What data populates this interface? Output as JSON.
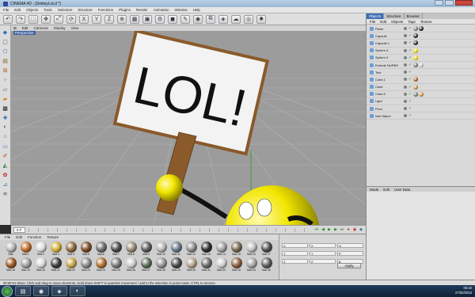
{
  "window": {
    "title": "CINEMA 4D - [SmileyLoLd *]"
  },
  "menubar": {
    "items": [
      "File",
      "Edit",
      "Objects",
      "Tools",
      "Selection",
      "Structure",
      "Functions",
      "Plugins",
      "Render",
      "Animation",
      "Window",
      "Help"
    ]
  },
  "viewport": {
    "menu": [
      "Edit",
      "Cameras",
      "Display",
      "View"
    ],
    "label": "Perspective",
    "sign_text": "LOL!"
  },
  "timeline": {
    "frame": "0 F"
  },
  "material_panel": {
    "menu": [
      "File",
      "Edit",
      "Function",
      "Texture"
    ],
    "materials": [
      {
        "name": "Mat",
        "color": "#b9b9b9"
      },
      {
        "name": "Mat.1",
        "color": "#c06a2a"
      },
      {
        "name": "Mat.2",
        "color": "#dcdcdc"
      },
      {
        "name": "Mat.3",
        "color": "#d4b23a"
      },
      {
        "name": "Mat.4",
        "color": "#8c6b3e"
      },
      {
        "name": "Mat.5",
        "color": "#7c4a22"
      },
      {
        "name": "Mat.6",
        "color": "#6f6f6f"
      },
      {
        "name": "Mat.7",
        "color": "#4a4a4a"
      },
      {
        "name": "Mat.8",
        "color": "#9a8c76"
      },
      {
        "name": "Mat.9",
        "color": "#5c5c5c"
      },
      {
        "name": "Mat.10",
        "color": "#b8b8b8"
      },
      {
        "name": "Mat.11",
        "color": "#6a7a8a"
      },
      {
        "name": "Mat.12",
        "color": "#8e8e8e"
      },
      {
        "name": "Mat.13",
        "color": "#2e2e2e"
      },
      {
        "name": "Mat.14",
        "color": "#a3a3a3"
      },
      {
        "name": "Mat.15",
        "color": "#7a6a52"
      },
      {
        "name": "Mat.16",
        "color": "#c2c2c2"
      },
      {
        "name": "Mat.17",
        "color": "#505050"
      },
      {
        "name": "Mat.18",
        "color": "#9a5a2a"
      },
      {
        "name": "Mat.19",
        "color": "#a0a0a0"
      },
      {
        "name": "Mat.20",
        "color": "#d9d9d9"
      },
      {
        "name": "Mat.21",
        "color": "#3c3c3c"
      },
      {
        "name": "Mat.22",
        "color": "#c8a850"
      },
      {
        "name": "Mat.23",
        "color": "#8a8a8a"
      },
      {
        "name": "Mat.24",
        "color": "#b07030"
      },
      {
        "name": "Mat.25",
        "color": "#7a7a7a"
      },
      {
        "name": "Mat.26",
        "color": "#cfcfcf"
      },
      {
        "name": "Mat.27",
        "color": "#5a6e5a"
      },
      {
        "name": "Mat.28",
        "color": "#959595"
      },
      {
        "name": "Mat.29",
        "color": "#484848"
      },
      {
        "name": "Mat.30",
        "color": "#b5a590"
      },
      {
        "name": "Mat.31",
        "color": "#6c6c6c"
      },
      {
        "name": "Mat.32",
        "color": "#d0d0d0"
      },
      {
        "name": "Mat.33",
        "color": "#8a6040"
      },
      {
        "name": "Mat.34",
        "color": "#a8a8a8"
      },
      {
        "name": "Mat.35",
        "color": "#5e5e5e"
      }
    ]
  },
  "coord_panel": {
    "rows": [
      [
        "X",
        "X",
        "H"
      ],
      [
        "Y",
        "Y",
        "P"
      ],
      [
        "Z",
        "Z",
        "B"
      ]
    ],
    "apply_label": "Apply"
  },
  "right_panel": {
    "tabs": [
      "Objects",
      "Structure",
      "Browser"
    ],
    "menu": [
      "File",
      "Edit",
      "Objects",
      "Tags",
      "Texture"
    ],
    "objects": [
      {
        "name": "Plane",
        "tags": [
          "#7a7a7a",
          "#1a1a1a"
        ]
      },
      {
        "name": "Capsule",
        "tags": [
          "#222222"
        ]
      },
      {
        "name": "Capsule.1",
        "tags": [
          "#222222"
        ]
      },
      {
        "name": "Sphere.4",
        "tags": [
          "#e8d200"
        ]
      },
      {
        "name": "Sphere.3",
        "tags": [
          "#e8d200"
        ]
      },
      {
        "name": "Extrude NURBS",
        "tags": [
          "#7a7a7a",
          "#c8c8c8"
        ]
      },
      {
        "name": "Text",
        "tags": []
      },
      {
        "name": "Cube.1",
        "tags": [
          "#b06020"
        ]
      },
      {
        "name": "Cube",
        "tags": [
          "#c88a4a"
        ]
      },
      {
        "name": "Cube.2",
        "tags": [
          "#7a7a7a",
          "#c88a4a"
        ]
      },
      {
        "name": "Light",
        "tags": []
      },
      {
        "name": "Floor",
        "tags": []
      },
      {
        "name": "Null Object",
        "tags": []
      }
    ],
    "attr_menu": [
      "Mode",
      "Edit",
      "User Data"
    ]
  },
  "statusbar": {
    "text": "00:00:01   Move: Click and drag to move elements. Hold down SHIFT to quantize movement / add to the selection in point mode, CTRL to remove."
  },
  "taskbar": {
    "time": "05:10",
    "date": "27/02/2010"
  },
  "colors": {
    "accent": "#3a6db8",
    "smiley": "#f2e600",
    "sign": "#f4f4f4",
    "sign_border": "#8a5a2a"
  }
}
